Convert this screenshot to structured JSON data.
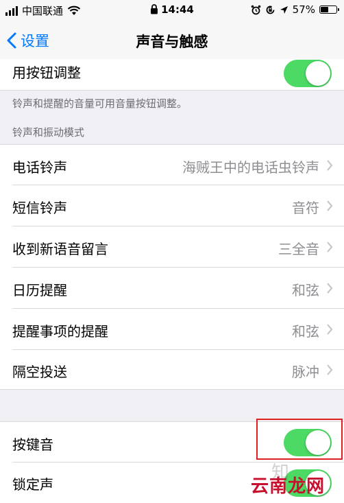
{
  "status_bar": {
    "carrier": "中国联通",
    "time": "14:44",
    "battery": "57%",
    "battery_level": 0.57
  },
  "nav": {
    "back_label": "设置",
    "title": "声音与触感"
  },
  "top_toggle": {
    "label": "用按钮调整",
    "on": true
  },
  "note": "铃声和提醒的音量可用音量按钮调整。",
  "section_header": "铃声和振动模式",
  "sound_rows": [
    {
      "label": "电话铃声",
      "value": "海贼王中的电话虫铃声"
    },
    {
      "label": "短信铃声",
      "value": "音符"
    },
    {
      "label": "收到新语音留言",
      "value": "三全音"
    },
    {
      "label": "日历提醒",
      "value": "和弦"
    },
    {
      "label": "提醒事项的提醒",
      "value": "和弦"
    },
    {
      "label": "隔空投送",
      "value": "脉冲"
    }
  ],
  "bottom_toggles": [
    {
      "label": "按键音",
      "on": true
    },
    {
      "label": "锁定声",
      "on": true
    }
  ],
  "watermark": {
    "text": "云南龙网",
    "faint": "知"
  },
  "colors": {
    "accent": "#007aff",
    "toggle_on": "#4cd964",
    "highlight": "#e02020"
  }
}
